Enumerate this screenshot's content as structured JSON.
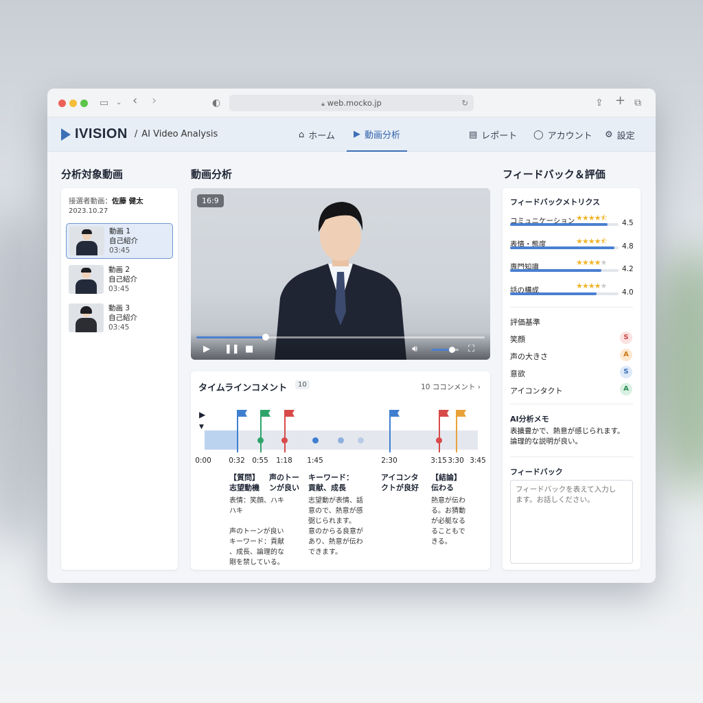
{
  "browser": {
    "url": "web.mocko.jp"
  },
  "app": {
    "logo": "IVISION",
    "separator": "/",
    "subtitle": "AI Video Analysis",
    "nav": {
      "home": "ホーム",
      "video_analysis": "動画分析",
      "report": "レポート",
      "account": "アカウント",
      "settings": "設定"
    }
  },
  "left": {
    "title": "分析対象動画",
    "candidate_label": "接選者動画：",
    "candidate_name": "佐藤 健太",
    "date": "2023.10.27",
    "videos": [
      {
        "name": "動画 1",
        "topic": "自己紹介",
        "duration": "03:45"
      },
      {
        "name": "動画 2",
        "topic": "自己紹介",
        "duration": "03:45"
      },
      {
        "name": "動画 3",
        "topic": "自己紹介",
        "duration": "03:45"
      }
    ]
  },
  "player": {
    "title": "動画分析",
    "aspect_badge": "16:9",
    "progress": 0.24,
    "volume": 0.75
  },
  "timeline": {
    "title": "タイムラインコメント",
    "count": "10",
    "comments_link": "10 ココンメント",
    "times": [
      "0:00",
      "0:32",
      "0:55",
      "1:18",
      "1:45",
      "2:30",
      "3:15",
      "3:30",
      "3:45"
    ],
    "comments": [
      {
        "title": "【質問】\n志望動機",
        "body": "表情：笑顔、ハキ\nハキ\n\n声のトーンが良い\nキーワード：貢献\n、成長、論理的な\n剛を禁している。"
      },
      {
        "title": "声のトー\nンが良い",
        "body": ""
      },
      {
        "title": "キーワード：\n貢献、成長",
        "body": "志望動が表情、話\n意ので、熱意が感\n弼じられます。\n意のからる良意が\nあり、熱意が伝わ\nできます。"
      },
      {
        "title": "アイコンタ\nクトが良好",
        "body": ""
      },
      {
        "title": "【結論】\n伝わる",
        "body": "熱意が伝わ\nる。お猜動\nが必艇なる\nることもで\nきる。"
      }
    ],
    "colors": {
      "blue": "#3f7fd0",
      "green": "#2fa46a",
      "red": "#d84a4a",
      "orange": "#e8a23a"
    }
  },
  "feedback": {
    "title": "フィードバック＆評価",
    "metrics_title": "フィードバックメトリクス",
    "metrics": [
      {
        "label": "コミュニケーション",
        "stars": "★★★★⯪",
        "value": "4.5",
        "level": 0.9
      },
      {
        "label": "表情・態度",
        "stars": "★★★★⯪",
        "value": "4.8",
        "level": 0.96
      },
      {
        "label": "専門知識",
        "stars": "★★★★★",
        "value": "4.2",
        "level": 0.84
      },
      {
        "label": "話の構成",
        "stars": "★★★★★",
        "value": "4.0",
        "level": 0.8
      }
    ],
    "criteria_title": "評価基準",
    "criteria": [
      {
        "label": "笑顔",
        "grade": "S"
      },
      {
        "label": "声の大きさ",
        "grade": "A"
      },
      {
        "label": "意欲",
        "grade": "S"
      },
      {
        "label": "アイコンタクト",
        "grade": "A"
      }
    ],
    "memo_title": "AI分析メモ",
    "memo": "表擴豊かで、熱意が感じられます。\n論理的な説明が良い。",
    "input_title": "フィードバック",
    "input_placeholder": "フィードバックを表えて入力し\nます。お話しください。"
  }
}
